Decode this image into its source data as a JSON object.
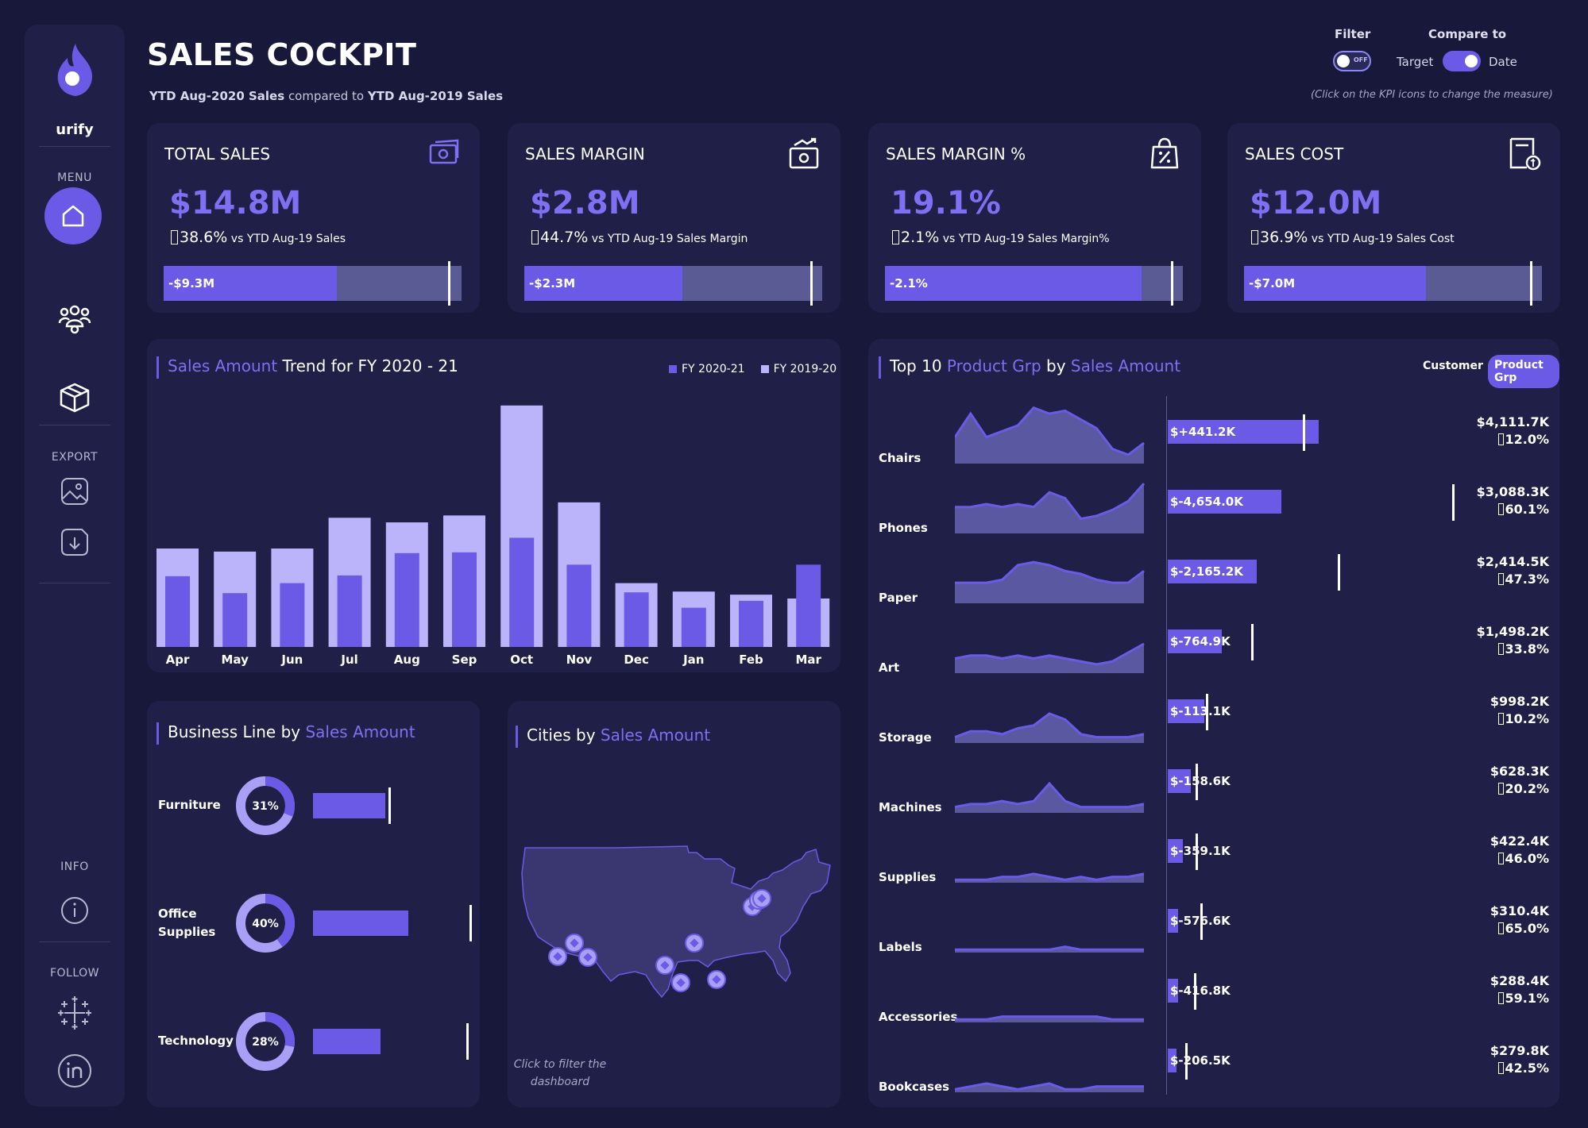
{
  "brand": {
    "name": "urify"
  },
  "sidebar": {
    "menu_label": "MENU",
    "export_label": "EXPORT",
    "info_label": "INFO",
    "follow_label": "FOLLOW",
    "items": [
      {
        "icon": "home-icon"
      },
      {
        "icon": "users-icon"
      },
      {
        "icon": "box-icon"
      }
    ]
  },
  "header": {
    "title": "SALES COCKPIT",
    "subtitle_current": "YTD Aug-2020 Sales",
    "subtitle_mid": "compared to",
    "subtitle_prior": "YTD Aug-2019 Sales",
    "filter_label": "Filter",
    "filter_toggle_text": "OFF",
    "compare_label": "Compare to",
    "compare_left": "Target",
    "compare_right": "Date",
    "hint": "(Click on the KPI icons to change the measure)"
  },
  "kpis": [
    {
      "title": "TOTAL SALES",
      "value": "$14.8M",
      "delta": "38.6%",
      "delta_text": "vs YTD Aug-19 Sales",
      "bar_label": "-$9.3M",
      "fill": 0.58,
      "marker": 0.955,
      "icon": "cash-icon"
    },
    {
      "title": "SALES MARGIN",
      "value": "$2.8M",
      "delta": "44.7%",
      "delta_text": "vs YTD Aug-19 Sales Margin",
      "bar_label": "-$2.3M",
      "fill": 0.53,
      "marker": 0.96,
      "icon": "money-growth-icon"
    },
    {
      "title": "SALES MARGIN %",
      "value": "19.1%",
      "delta": "2.1%",
      "delta_text": "vs YTD Aug-19 Sales Margin%",
      "bar_label": "-2.1%",
      "fill": 0.86,
      "marker": 0.96,
      "icon": "discount-bag-icon"
    },
    {
      "title": "SALES COST",
      "value": "$12.0M",
      "delta": "36.9%",
      "delta_text": "vs YTD Aug-19 Sales Cost",
      "bar_label": "-$7.0M",
      "fill": 0.61,
      "marker": 0.96,
      "icon": "cost-document-icon"
    }
  ],
  "trend": {
    "title_hl": "Sales Amount",
    "title_rest": "Trend for FY 2020 - 21",
    "legend_current": "FY 2020-21",
    "legend_prior": "FY 2019-20"
  },
  "chart_data": {
    "type": "bar",
    "categories": [
      "Apr",
      "May",
      "Jun",
      "Jul",
      "Aug",
      "Sep",
      "Oct",
      "Nov",
      "Dec",
      "Jan",
      "Feb",
      "Mar"
    ],
    "series": [
      {
        "name": "FY 2020-21",
        "values": [
          0.92,
          0.7,
          0.83,
          0.93,
          1.22,
          1.23,
          1.42,
          1.07,
          0.71,
          0.51,
          0.6,
          1.07
        ]
      },
      {
        "name": "FY 2019-20",
        "values": [
          1.28,
          1.24,
          1.28,
          1.68,
          1.62,
          1.71,
          3.14,
          1.88,
          0.83,
          0.72,
          0.68,
          0.63
        ]
      }
    ],
    "colors": {
      "current": "#6a5ae6",
      "prior": "#bcb4fb"
    },
    "ylim": [
      0,
      3.2
    ]
  },
  "business_line": {
    "title_rest": "Business Line by",
    "title_hl": "Sales Amount",
    "rows": [
      {
        "label": "Furniture",
        "pct": "31%",
        "share": 0.31,
        "bar": 0.57,
        "marker": 0.6
      },
      {
        "label": "Office Supplies",
        "pct": "40%",
        "share": 0.4,
        "bar": 0.75,
        "marker": 1.24
      },
      {
        "label": "Technology",
        "pct": "28%",
        "share": 0.28,
        "bar": 0.53,
        "marker": 1.21
      }
    ]
  },
  "cities": {
    "title_rest": "Cities by",
    "title_hl": "Sales Amount",
    "note": "Click to filter the dashboard"
  },
  "top10": {
    "title_pre": "Top 10",
    "title_hl1": "Product Grp",
    "title_mid": "by",
    "title_hl2": "Sales Amount",
    "tab_customer": "Customer",
    "tab_product": "Product Grp",
    "rows": [
      {
        "label": "Chairs",
        "diff": "$+441.2K",
        "amount": "$4,111.7K",
        "pct": "12.0%",
        "bar": 1.0,
        "marker": 0.9,
        "spark": [
          0.45,
          0.85,
          0.45,
          0.55,
          0.65,
          0.95,
          0.85,
          0.9,
          0.75,
          0.6,
          0.25,
          0.15,
          0.35
        ]
      },
      {
        "label": "Phones",
        "diff": "$-4,654.0K",
        "amount": "$3,088.3K",
        "pct": "60.1%",
        "bar": 0.75,
        "marker": 1.89,
        "spark": [
          0.45,
          0.45,
          0.5,
          0.45,
          0.5,
          0.45,
          0.7,
          0.6,
          0.25,
          0.3,
          0.4,
          0.55,
          0.85
        ]
      },
      {
        "label": "Paper",
        "diff": "$-2,165.2K",
        "amount": "$2,414.5K",
        "pct": "47.3%",
        "bar": 0.59,
        "marker": 1.13,
        "spark": [
          0.35,
          0.35,
          0.35,
          0.4,
          0.65,
          0.7,
          0.65,
          0.55,
          0.5,
          0.4,
          0.35,
          0.35,
          0.55
        ]
      },
      {
        "label": "Art",
        "diff": "$-764.9K",
        "amount": "$1,498.2K",
        "pct": "33.8%",
        "bar": 0.36,
        "marker": 0.56,
        "spark": [
          0.25,
          0.3,
          0.3,
          0.25,
          0.3,
          0.25,
          0.3,
          0.25,
          0.2,
          0.15,
          0.2,
          0.35,
          0.5
        ]
      },
      {
        "label": "Storage",
        "diff": "$-113.1K",
        "amount": "$998.2K",
        "pct": "10.2%",
        "bar": 0.24,
        "marker": 0.26,
        "spark": [
          0.1,
          0.2,
          0.2,
          0.15,
          0.25,
          0.3,
          0.5,
          0.4,
          0.15,
          0.1,
          0.1,
          0.1,
          0.15
        ]
      },
      {
        "label": "Machines",
        "diff": "$-158.6K",
        "amount": "$628.3K",
        "pct": "20.2%",
        "bar": 0.15,
        "marker": 0.19,
        "spark": [
          0.1,
          0.15,
          0.15,
          0.2,
          0.15,
          0.2,
          0.5,
          0.2,
          0.1,
          0.1,
          0.1,
          0.1,
          0.15
        ]
      },
      {
        "label": "Supplies",
        "diff": "$-359.1K",
        "amount": "$422.4K",
        "pct": "46.0%",
        "bar": 0.1,
        "marker": 0.19,
        "spark": [
          0.05,
          0.05,
          0.05,
          0.1,
          0.1,
          0.15,
          0.1,
          0.05,
          0.1,
          0.05,
          0.1,
          0.1,
          0.15
        ]
      },
      {
        "label": "Labels",
        "diff": "$-576.6K",
        "amount": "$310.4K",
        "pct": "65.0%",
        "bar": 0.07,
        "marker": 0.22,
        "spark": [
          0.05,
          0.05,
          0.05,
          0.05,
          0.05,
          0.05,
          0.05,
          0.1,
          0.05,
          0.05,
          0.05,
          0.05,
          0.05
        ]
      },
      {
        "label": "Accessories",
        "diff": "$-416.8K",
        "amount": "$288.4K",
        "pct": "59.1%",
        "bar": 0.07,
        "marker": 0.18,
        "spark": [
          0.05,
          0.05,
          0.05,
          0.1,
          0.1,
          0.1,
          0.1,
          0.1,
          0.1,
          0.1,
          0.05,
          0.05,
          0.05
        ]
      },
      {
        "label": "Bookcases",
        "diff": "$-206.5K",
        "amount": "$279.8K",
        "pct": "42.5%",
        "bar": 0.06,
        "marker": 0.12,
        "spark": [
          0.05,
          0.1,
          0.15,
          0.1,
          0.05,
          0.1,
          0.15,
          0.05,
          0.05,
          0.1,
          0.1,
          0.1,
          0.1
        ]
      }
    ]
  },
  "colors": {
    "accent": "#6a5ae6",
    "accent_light": "#bcb4fb",
    "background": "#18183a",
    "card": "#1f1f47"
  }
}
